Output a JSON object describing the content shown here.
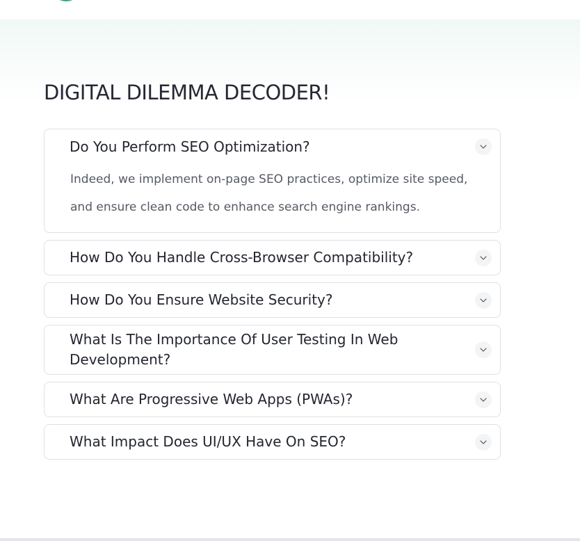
{
  "header": {
    "logo_icon": "logo-arc",
    "logo_color": "#1fb07a"
  },
  "section": {
    "title": "DIGITAL DILEMMA DECODER!"
  },
  "faq": {
    "items": [
      {
        "question": "Do You Perform SEO Optimization?",
        "answer": "Indeed, we implement on-page SEO practices, optimize site speed, and ensure clean code to enhance search engine rankings.",
        "expanded": true
      },
      {
        "question": "How Do You Handle Cross-Browser Compatibility?",
        "expanded": false
      },
      {
        "question": "How Do You Ensure Website Security?",
        "expanded": false
      },
      {
        "question": "What Is The Importance Of User Testing In Web Development?",
        "expanded": false
      },
      {
        "question": "What Are Progressive Web Apps (PWAs)?",
        "expanded": false
      },
      {
        "question": "What Impact Does UI/UX Have On SEO?",
        "expanded": false
      }
    ],
    "toggle_icon": "chevron-down-icon"
  }
}
